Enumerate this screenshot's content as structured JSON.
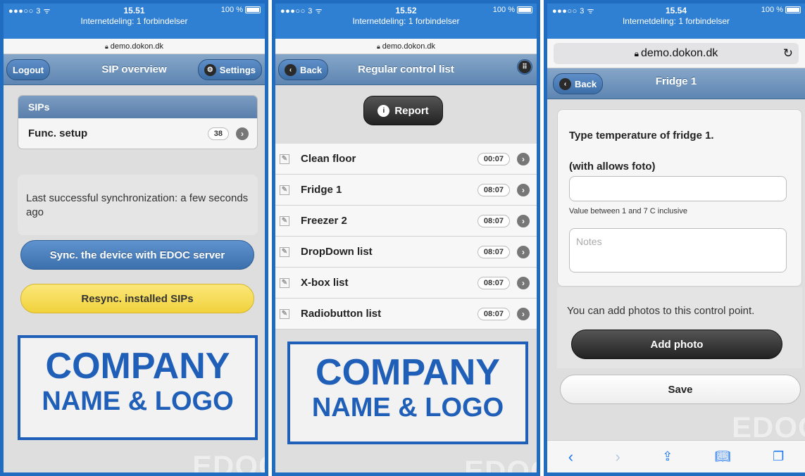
{
  "status_bars": [
    {
      "signal": "●●●○○ 3 ᯤ",
      "time": "15.51",
      "battery": "100 %",
      "tether": "Internetdeling: 1 forbindelser"
    },
    {
      "signal": "●●●○○ 3 ᯤ",
      "time": "15.52",
      "battery": "100 %",
      "tether": "Internetdeling: 1 forbindelser"
    },
    {
      "signal": "●●●○○ 3 ᯤ",
      "time": "15.54",
      "battery": "100 %",
      "tether": "Internetdeling: 1 forbindelser"
    }
  ],
  "url": "demo.dokon.dk",
  "screen1": {
    "title": "SIP overview",
    "logout": "Logout",
    "settings": "Settings",
    "sips_header": "SIPs",
    "row_label": "Func. setup",
    "row_count": "38",
    "sync_text": "Last successful synchronization: a few seconds ago",
    "sync_button": "Sync. the device with EDOC server",
    "resync_button": "Resync. installed SIPs",
    "logo_line1": "COMPANY",
    "logo_line2": "NAME & LOGO",
    "watermark": "EDOC"
  },
  "screen2": {
    "title": "Regular control list",
    "back": "Back",
    "report": "Report",
    "items": [
      {
        "label": "Clean floor",
        "time": "00:07"
      },
      {
        "label": "Fridge 1",
        "time": "08:07"
      },
      {
        "label": "Freezer 2",
        "time": "08:07"
      },
      {
        "label": "DropDown list",
        "time": "08:07"
      },
      {
        "label": "X-box list",
        "time": "08:07"
      },
      {
        "label": "Radiobutton list",
        "time": "08:07"
      }
    ],
    "logo_line1": "COMPANY",
    "logo_line2": "NAME & LOGO",
    "watermark": "EDOC"
  },
  "screen3": {
    "title": "Fridge 1",
    "back": "Back",
    "question": "Type temperature of fridge 1.",
    "sub": "(with allows foto)",
    "value_input": "",
    "hint": "Value between 1 and 7 C inclusive",
    "notes_placeholder": "Notes",
    "photo_text": "You can add photos to this control point.",
    "add_photo": "Add photo",
    "save": "Save",
    "watermark": "EDOC"
  },
  "colors": {
    "frame": "#1f6cc1",
    "header": "#6b8fb9",
    "sync_button": "#4b80bd",
    "resync_button": "#f5d94a",
    "logo": "#1f5fb8",
    "ios_blue": "#1e78f0"
  }
}
